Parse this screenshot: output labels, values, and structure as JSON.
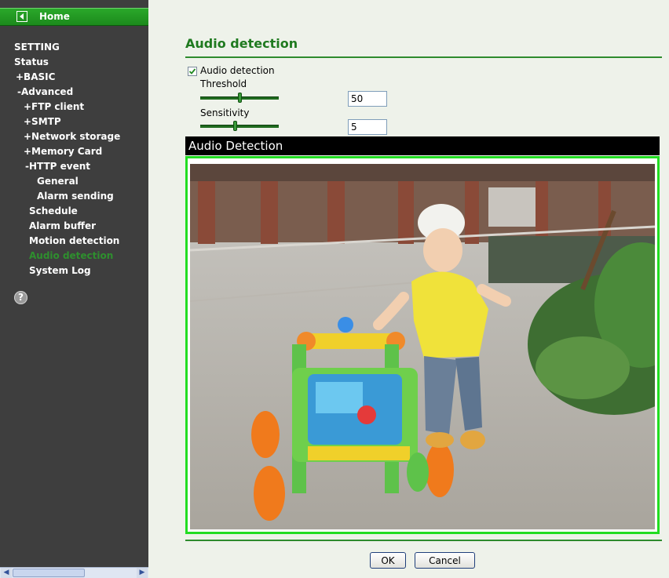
{
  "sidebar": {
    "home_label": "Home",
    "setting": "SETTING",
    "status": "Status",
    "basic": "+BASIC",
    "advanced": "-Advanced",
    "ftp_client": "+FTP client",
    "smtp": "+SMTP",
    "network_storage": "+Network storage",
    "memory_card": "+Memory Card",
    "http_event": "-HTTP event",
    "general": "General",
    "alarm_sending": "Alarm sending",
    "schedule": "Schedule",
    "alarm_buffer": "Alarm buffer",
    "motion_detection": "Motion detection",
    "audio_detection": "Audio detection",
    "system_log": "System Log",
    "help_glyph": "?",
    "active_color": "#2e8f2e"
  },
  "main": {
    "title": "Audio detection",
    "audio_detection_checkbox_label": "Audio detection",
    "audio_detection_checked": true,
    "threshold_label": "Threshold",
    "threshold_value": "50",
    "threshold_level": 0.5,
    "sensitivity_label": "Sensitivity",
    "sensitivity_value": "5",
    "sensitivity_level": 0.44,
    "video_title": "Audio Detection",
    "ok_label": "OK",
    "cancel_label": "Cancel"
  },
  "icons": {
    "home": "back-arrow-icon",
    "help": "help-icon",
    "checkbox": "checkmark-icon"
  },
  "colors": {
    "accent_green": "#1f7a1f",
    "video_border": "#22dd22",
    "sidebar_bg": "#3e3e3e",
    "page_bg": "#eef2ea"
  }
}
